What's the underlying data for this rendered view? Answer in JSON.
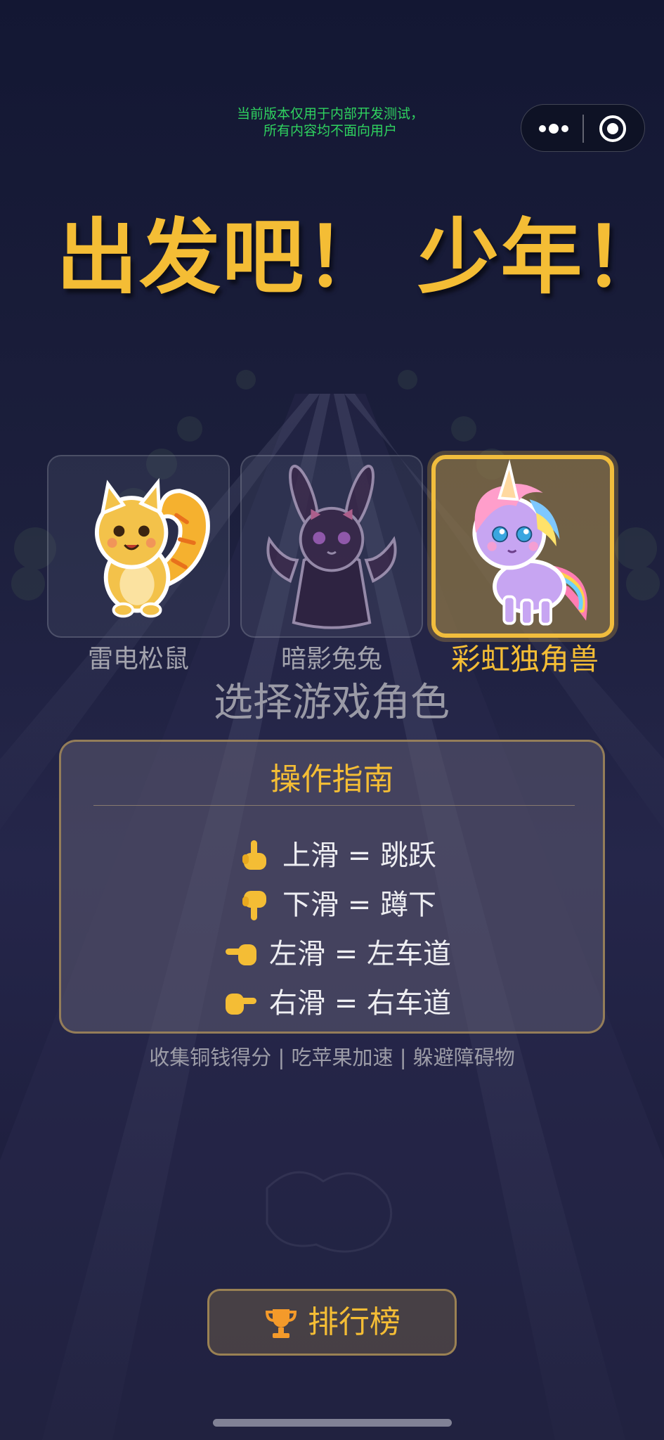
{
  "dev_notice": {
    "line1": "当前版本仅用于内部开发测试，",
    "line2": "所有内容均不面向用户"
  },
  "capsule": {
    "more_icon": "more-dots-icon",
    "close_icon": "target-close-icon"
  },
  "title": "出发吧！ 少年！",
  "characters": [
    {
      "name": "雷电松鼠",
      "icon": "squirrel",
      "selected": false
    },
    {
      "name": "暗影兔兔",
      "icon": "bunny",
      "selected": false
    },
    {
      "name": "彩虹独角兽",
      "icon": "unicorn",
      "selected": true
    }
  ],
  "select_label": "选择游戏角色",
  "guide": {
    "title": "操作指南",
    "items": [
      {
        "icon": "hand-pointing-up-icon",
        "text": "上滑 = 跳跃"
      },
      {
        "icon": "hand-pointing-down-icon",
        "text": "下滑 = 蹲下"
      },
      {
        "icon": "hand-pointing-left-icon",
        "text": "左滑 = 左车道"
      },
      {
        "icon": "hand-pointing-right-icon",
        "text": "右滑 = 右车道"
      }
    ]
  },
  "tips": "收集铜钱得分 | 吃苹果加速 | 躲避障碍物",
  "leaderboard": {
    "icon": "trophy-icon",
    "label": "排行榜"
  },
  "colors": {
    "accent": "#f4bd35",
    "dev_notice": "#2fd25f",
    "background": "#1c1f3c"
  }
}
